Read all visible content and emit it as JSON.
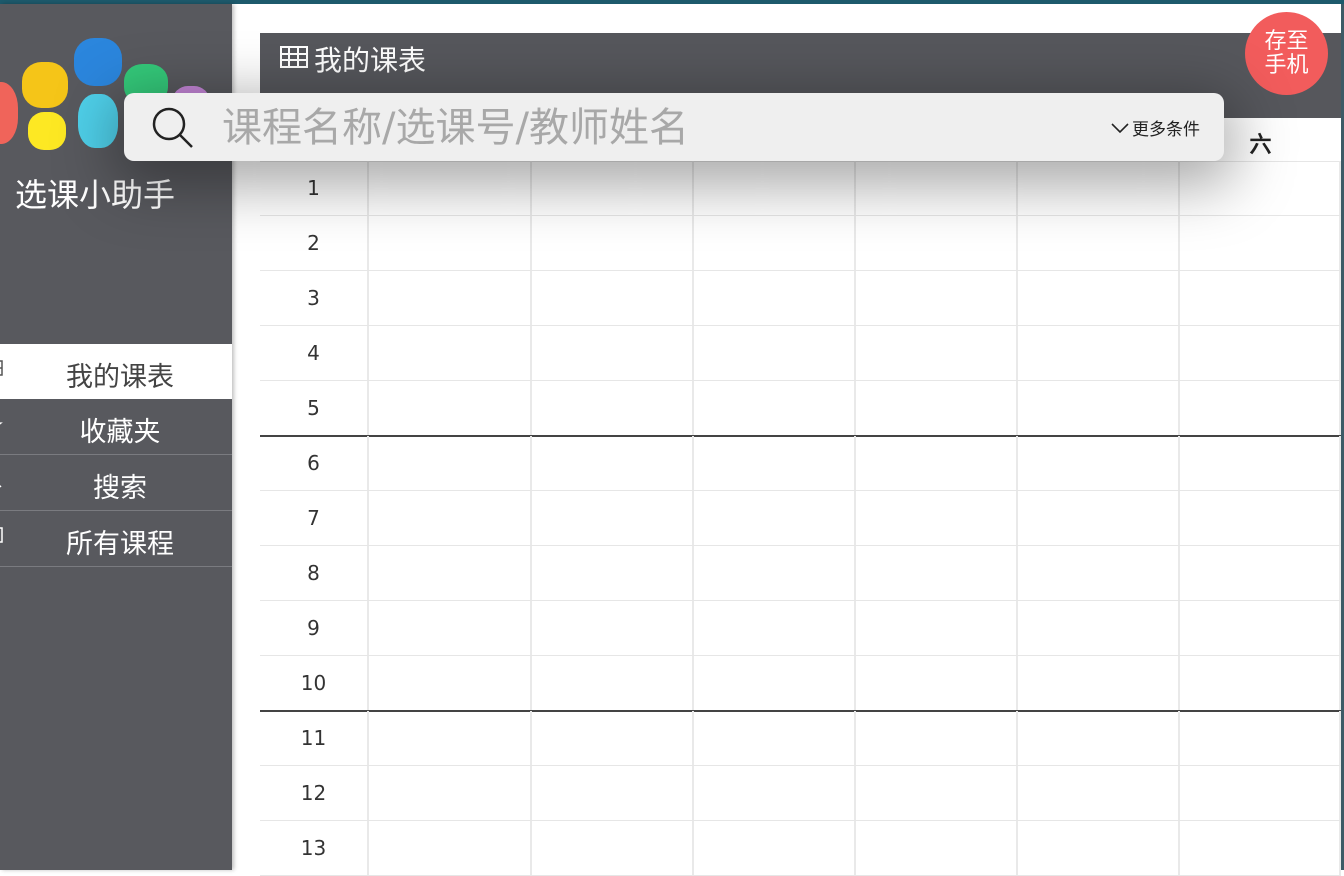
{
  "app": {
    "title": "选课小助手",
    "logo_colors": [
      "#f0645a",
      "#f5c518",
      "#2b86dd",
      "#34c97a",
      "#4fd0ea",
      "#fde823",
      "#c586d8"
    ]
  },
  "sidebar": {
    "items": [
      {
        "label": "我的课表",
        "icon": "table-icon",
        "active": true
      },
      {
        "label": "收藏夹",
        "icon": "star-icon",
        "active": false
      },
      {
        "label": "搜索",
        "icon": "search-icon",
        "active": false
      },
      {
        "label": "所有课程",
        "icon": "list-icon",
        "active": false
      }
    ]
  },
  "main": {
    "title": "我的课表",
    "title_icon": "table-icon",
    "save_button": {
      "line1": "存至",
      "line2": "手机",
      "color": "#f25c5c"
    }
  },
  "search": {
    "placeholder": "课程名称/选课号/教师姓名",
    "value": "",
    "more_label": "更多条件",
    "icon": "search-icon",
    "more_icon": "chevron-down-icon"
  },
  "schedule": {
    "visible_day_header": "六",
    "periods": [
      "1",
      "2",
      "3",
      "4",
      "5",
      "6",
      "7",
      "8",
      "9",
      "10",
      "11",
      "12",
      "13"
    ],
    "section_breaks_after": [
      5,
      10
    ],
    "columns_visible": 7
  },
  "colors": {
    "sidebar": "#58595e",
    "header": "#56575c",
    "accent_top": "#1d5a6c"
  }
}
